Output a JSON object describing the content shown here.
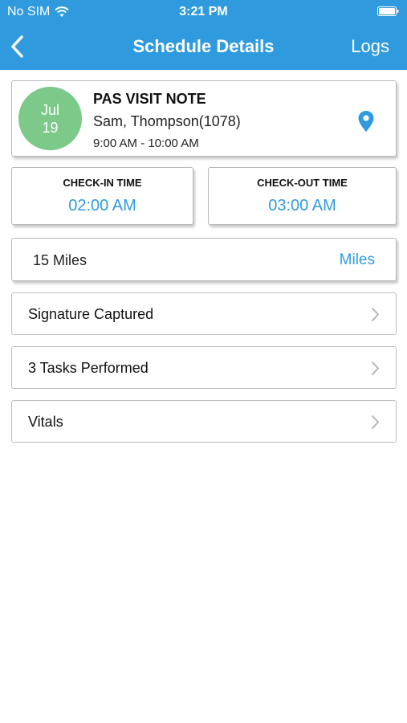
{
  "status_bar": {
    "carrier": "No SIM",
    "time": "3:21 PM",
    "wifi_icon": "wifi-icon",
    "battery_icon": "battery-icon"
  },
  "navbar": {
    "title": "Schedule Details",
    "right_label": "Logs",
    "back_icon": "chevron-left-icon",
    "color": "#2f9bde"
  },
  "visit": {
    "month": "Jul",
    "day": "19",
    "title": "PAS VISIT NOTE",
    "client": "Sam, Thompson(1078)",
    "time_range": "9:00 AM - 10:00 AM",
    "date_color": "#7cc98a",
    "location_icon": "map-pin-icon"
  },
  "check_in": {
    "label": "CHECK-IN TIME",
    "value": "02:00 AM"
  },
  "check_out": {
    "label": "CHECK-OUT TIME",
    "value": "03:00 AM"
  },
  "miles": {
    "value": "15 Miles",
    "link_label": "Miles"
  },
  "rows": [
    {
      "label": "Signature Captured"
    },
    {
      "label": "3 Tasks Performed"
    },
    {
      "label": "Vitals"
    }
  ],
  "accent_color": "#2f9bde"
}
